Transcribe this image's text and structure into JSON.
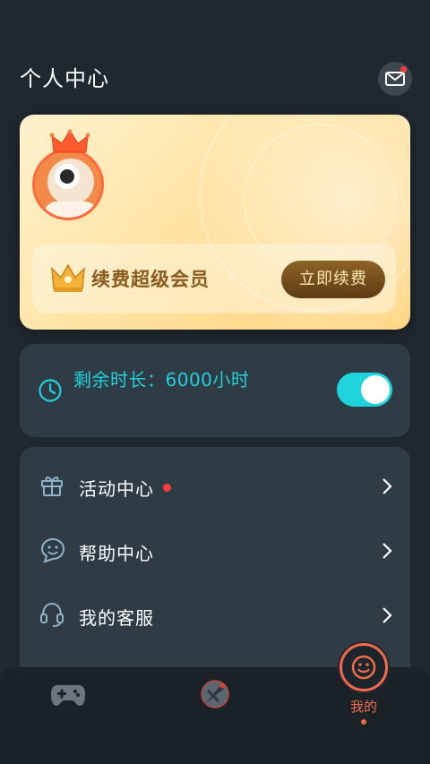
{
  "header": {
    "title": "个人中心",
    "mail_icon": "mail-icon"
  },
  "vip_card": {
    "renew_label": "续费超级会员",
    "renew_button": "立即续费"
  },
  "time_card": {
    "text": "剩余时长：6000小时",
    "toggle_on": true
  },
  "menu": {
    "items": [
      {
        "label": "活动中心",
        "icon": "gift-icon",
        "has_dot": true
      },
      {
        "label": "帮助中心",
        "icon": "chat-smile-icon",
        "has_dot": false
      },
      {
        "label": "我的客服",
        "icon": "headset-icon",
        "has_dot": false
      }
    ]
  },
  "tabbar": {
    "tabs": [
      {
        "icon": "gamepad-icon"
      },
      {
        "icon": "rocket-icon"
      },
      {
        "label": "我的",
        "icon": "smile-icon",
        "active": true
      }
    ]
  },
  "colors": {
    "accent": "#1fd3dc",
    "active_tab": "#f26a4a",
    "gold": "#ffd27a"
  }
}
